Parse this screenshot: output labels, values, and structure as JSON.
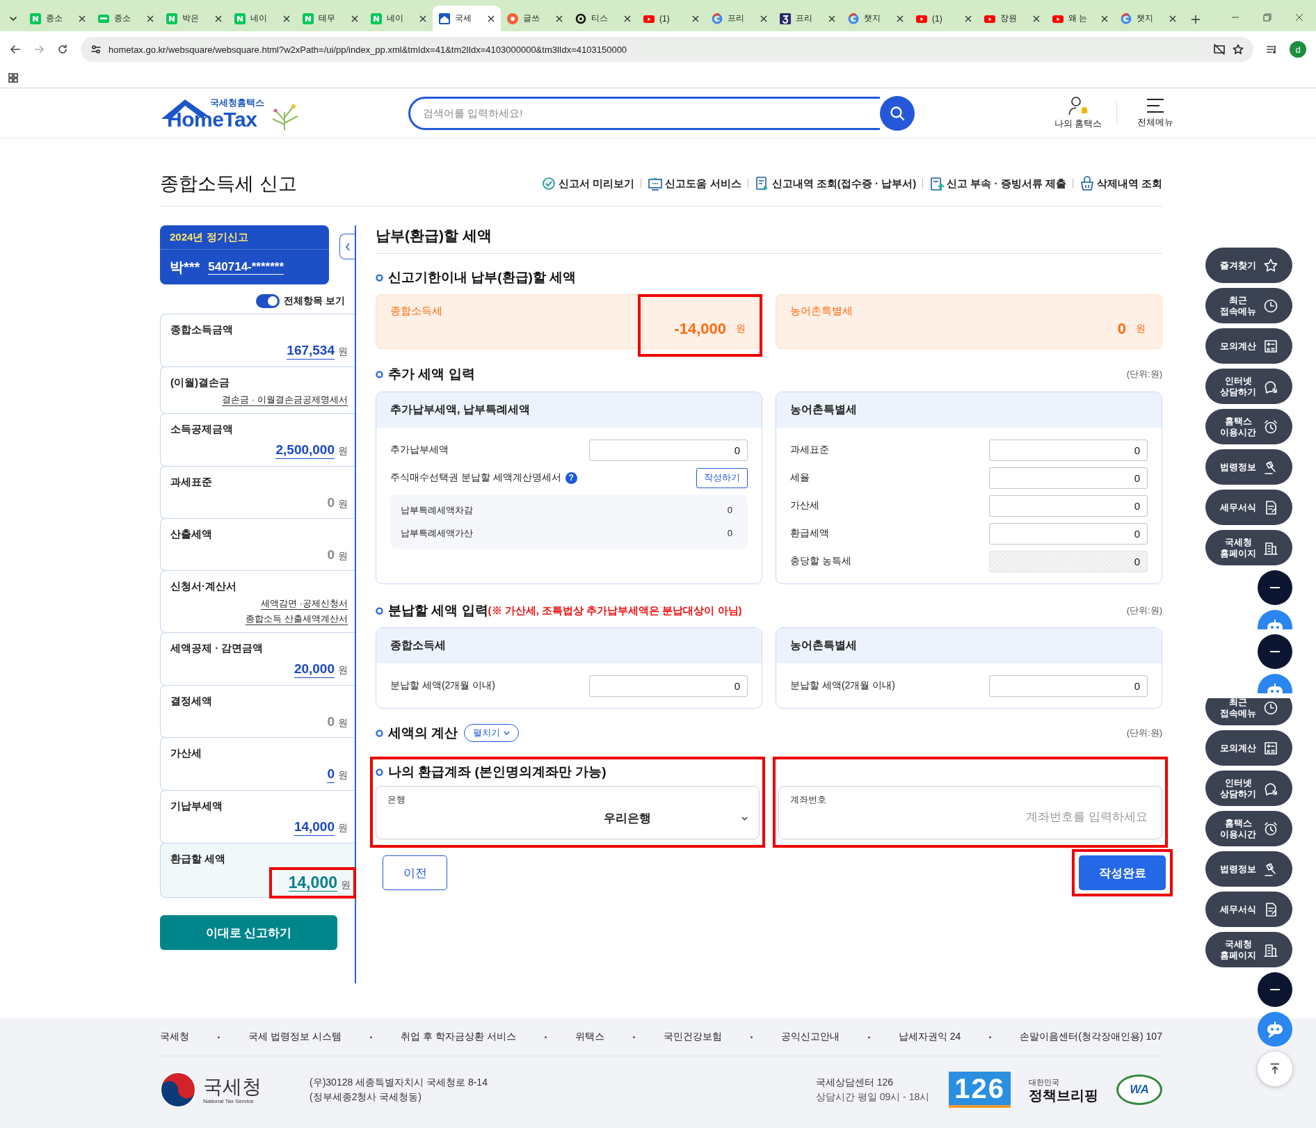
{
  "browser": {
    "tabs": [
      {
        "title": "종소",
        "selected": false
      },
      {
        "title": "종소",
        "selected": false
      },
      {
        "title": "박은",
        "selected": false
      },
      {
        "title": "네이",
        "selected": false
      },
      {
        "title": "테무",
        "selected": false
      },
      {
        "title": "네이",
        "selected": false
      },
      {
        "title": "국세",
        "selected": true
      },
      {
        "title": "글쓰",
        "selected": false
      },
      {
        "title": "티스",
        "selected": false
      },
      {
        "title": "(1)",
        "selected": false
      },
      {
        "title": "프리",
        "selected": false
      },
      {
        "title": "프리",
        "selected": false
      },
      {
        "title": "챗지",
        "selected": false
      },
      {
        "title": "(1)",
        "selected": false
      },
      {
        "title": "장원",
        "selected": false
      },
      {
        "title": "왜 는",
        "selected": false
      },
      {
        "title": "챗지",
        "selected": false
      }
    ],
    "url": "hometax.go.kr/websquare/websquare.html?w2xPath=/ui/pp/index_pp.xml&tmIdx=41&tm2lIdx=4103000000&tm3lIdx=4103150000",
    "profile_initial": "d"
  },
  "header": {
    "logo_caption": "국세청홈택스",
    "logo_text": "HomeTax",
    "search": {
      "placeholder": "검색어를 입력하세요!"
    },
    "actions": [
      "나의 홈택스",
      "전체메뉴"
    ]
  },
  "page": {
    "title": "종합소득세 신고",
    "links": [
      "신고서 미리보기",
      "신고도움 서비스",
      "신고내역 조회(접수증 · 납부서)",
      "신고 부속 · 증빙서류 제출",
      "삭제내역 조회"
    ]
  },
  "sidebar": {
    "period": "2024년 정기신고",
    "name": "박***",
    "id": "540714-*******",
    "toggle": {
      "label": "전체항목 보기",
      "on": true
    },
    "items": [
      {
        "kind": "amount",
        "label": "종합소득금액",
        "value": "167,534",
        "unit": "원",
        "linked": true
      },
      {
        "kind": "links",
        "label": "(이월)결손금",
        "links": [
          "결손금 · 이월결손금공제명세서"
        ]
      },
      {
        "kind": "amount",
        "label": "소득공제금액",
        "value": "2,500,000",
        "unit": "원",
        "linked": true
      },
      {
        "kind": "amount",
        "label": "과세표준",
        "value": "0",
        "unit": "원",
        "linked": false
      },
      {
        "kind": "amount",
        "label": "산출세액",
        "value": "0",
        "unit": "원",
        "linked": false
      },
      {
        "kind": "links",
        "label": "신청서·계산서",
        "links": [
          "세액감면 ·공제신청서",
          "종합소득 산출세액계산서"
        ]
      },
      {
        "kind": "amount",
        "label": "세액공제 · 감면금액",
        "value": "20,000",
        "unit": "원",
        "linked": true
      },
      {
        "kind": "amount",
        "label": "결정세액",
        "value": "0",
        "unit": "원",
        "linked": false
      },
      {
        "kind": "amount",
        "label": "가산세",
        "value": "0",
        "unit": "원",
        "linked": true
      },
      {
        "kind": "amount",
        "label": "기납부세액",
        "value": "14,000",
        "unit": "원",
        "linked": true
      },
      {
        "kind": "total",
        "label": "환급할 세액",
        "value": "14,000",
        "unit": "원",
        "linked": true,
        "highlighted": true
      }
    ],
    "submit": "이대로 신고하기"
  },
  "main": {
    "title": "납부(환급)할 세액",
    "due": {
      "title": "신고기한이내 납부(환급)할 세액",
      "cards": [
        {
          "label": "종합소득세",
          "value": "-14,000",
          "unit": "원",
          "highlighted": true
        },
        {
          "label": "농어촌특별세",
          "value": "0",
          "unit": "원",
          "highlighted": false
        }
      ]
    },
    "additional": {
      "title": "추가 세액 입력",
      "unit_note": "(단위:원)",
      "panels": [
        {
          "title": "추가납부세액, 납부특례세액",
          "rows": [
            {
              "kind": "input",
              "label": "추가납부세액",
              "value": "0",
              "disabled": false
            },
            {
              "kind": "action",
              "label": "주식매수선택권 분납할 세액계산명세서",
              "help": "?",
              "button": "작성하기"
            },
            {
              "kind": "sub",
              "items": [
                {
                  "label": "납부특례세액차감",
                  "value": "0"
                },
                {
                  "label": "납부특례세액가산",
                  "value": "0"
                }
              ]
            }
          ]
        },
        {
          "title": "농어촌특별세",
          "rows": [
            {
              "kind": "input",
              "label": "과세표준",
              "value": "0",
              "disabled": false
            },
            {
              "kind": "input",
              "label": "세율",
              "value": "0",
              "disabled": false
            },
            {
              "kind": "input",
              "label": "가산세",
              "value": "0",
              "disabled": false
            },
            {
              "kind": "input",
              "label": "환급세액",
              "value": "0",
              "disabled": false
            },
            {
              "kind": "input",
              "label": "충당할 농특세",
              "value": "0",
              "disabled": true
            }
          ]
        }
      ]
    },
    "installment": {
      "title": "분납할 세액 입력",
      "note": "(※ 가산세, 조특법상 추가납부세액은 분납대상이 아님)",
      "unit_note": "(단위:원)",
      "panels": [
        {
          "title": "종합소득세",
          "rows": [
            {
              "kind": "input",
              "label": "분납할 세액(2개월 이내)",
              "value": "0",
              "disabled": false
            }
          ]
        },
        {
          "title": "농어촌특별세",
          "rows": [
            {
              "kind": "input",
              "label": "분납할 세액(2개월 이내)",
              "value": "0",
              "disabled": false
            }
          ]
        }
      ]
    },
    "calculation": {
      "title": "세액의 계산",
      "toggle": "펼치기",
      "expanded": false,
      "unit_note": "(단위:원)"
    },
    "account": {
      "title": "나의 환급계좌 (본인명의계좌만 가능)",
      "highlighted": true,
      "bank": {
        "label": "은행",
        "value": "우리은행"
      },
      "number": {
        "label": "계좌번호",
        "placeholder": "계좌번호를 입력하세요",
        "highlighted": true
      }
    },
    "buttons": [
      {
        "kind": "secondary",
        "label": "이전",
        "highlighted": false
      },
      {
        "kind": "primary",
        "label": "작성완료",
        "highlighted": true
      }
    ]
  },
  "float_menu": [
    {
      "kind": "pill",
      "label": "즐겨찾기"
    },
    {
      "kind": "pill",
      "label": "최근 접속메뉴"
    },
    {
      "kind": "pill",
      "label": "모의계산"
    },
    {
      "kind": "pill",
      "label": "인터넷 상담하기"
    },
    {
      "kind": "pill",
      "label": "홈택스 이용시간"
    },
    {
      "kind": "pill",
      "label": "법령정보"
    },
    {
      "kind": "pill",
      "label": "세무서식"
    },
    {
      "kind": "pill",
      "label": "국세청 홈페이지"
    },
    {
      "kind": "minus"
    },
    {
      "kind": "bot",
      "clipped": true
    },
    {
      "kind": "minus"
    },
    {
      "kind": "bot",
      "clipped": true
    },
    {
      "kind": "pill",
      "label": "최근 접속메뉴",
      "clipped": true
    },
    {
      "kind": "pill",
      "label": "모의계산"
    },
    {
      "kind": "pill",
      "label": "인터넷 상담하기"
    },
    {
      "kind": "pill",
      "label": "홈택스 이용시간"
    },
    {
      "kind": "pill",
      "label": "법령정보"
    },
    {
      "kind": "pill",
      "label": "세무서식"
    },
    {
      "kind": "pill",
      "label": "국세청 홈페이지"
    },
    {
      "kind": "minus"
    },
    {
      "kind": "bot",
      "clipped": false
    },
    {
      "kind": "top"
    }
  ],
  "footer": {
    "links": [
      "국세청",
      "국세 법령정보 시스템",
      "취업 후 학자금상환 서비스",
      "위택스",
      "국민건강보험",
      "공익신고안내",
      "납세자권익 24",
      "손말이음센터(청각장애인용) 107"
    ],
    "org": "국세청",
    "org_en": "National Tax Service",
    "address": [
      "(우)30128 세종특별자치시 국세청로 8-14",
      "(정부세종2청사 국세청동)"
    ],
    "contact": [
      "국세상담센터 126",
      "상담시간 평일 09시 - 18시"
    ],
    "badges": {
      "hotline": "126",
      "briefing_top": "대한민국",
      "briefing": "정책브리핑",
      "wa": "WA"
    }
  }
}
